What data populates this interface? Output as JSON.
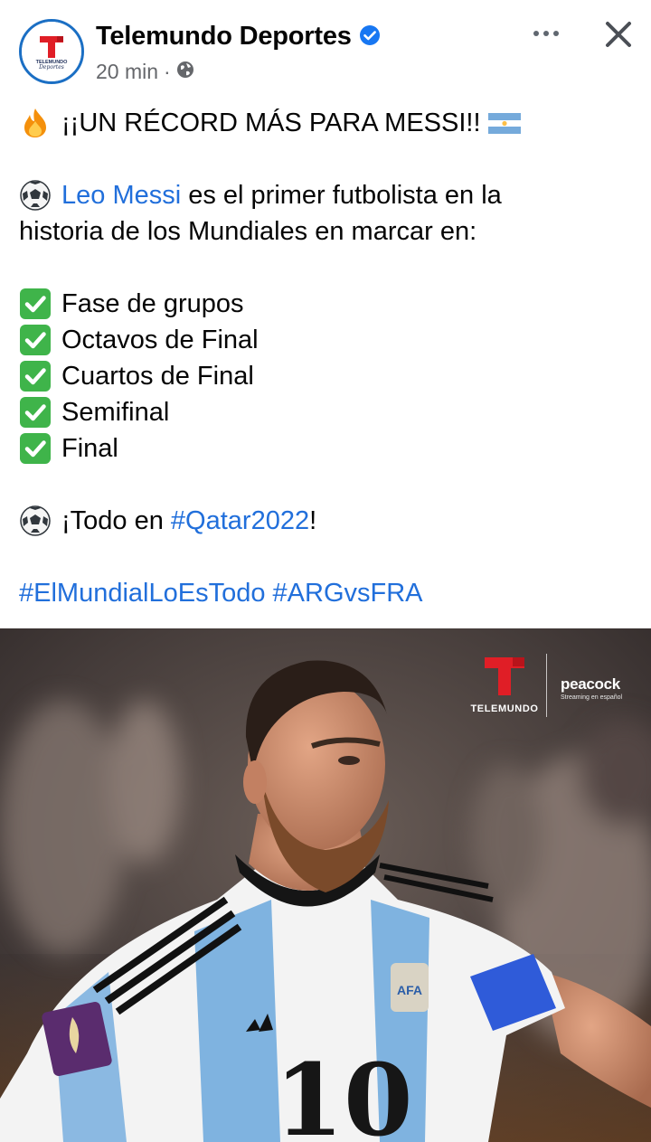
{
  "header": {
    "page_name": "Telemundo Deportes",
    "time": "20 min",
    "separator": "·",
    "avatar_text": "TELEMUNDO Deportes"
  },
  "post": {
    "line1": "¡¡UN RÉCORD MÁS PARA MESSI!!",
    "line2_link": "Leo Messi",
    "line2_rest": " es el primer futbolista en la",
    "line3": "historia de los Mundiales en marcar en:",
    "checks": [
      "Fase de grupos",
      "Octavos de Final",
      "Cuartos de Final",
      "Semifinal",
      "Final"
    ],
    "todo_prefix": "¡Todo en ",
    "todo_hashtag": "#Qatar2022",
    "todo_suffix": "!",
    "hashtag1": "#ElMundialLoEsTodo",
    "hashtag2": "#ARGvsFRA"
  },
  "image": {
    "brand": "TELEMUNDO",
    "partner": "peacock",
    "partner_sub": "Streaming en español",
    "jersey_number": "10"
  },
  "icons": {
    "verified": "verified-badge-icon",
    "globe": "globe-icon",
    "more": "more-options-icon",
    "close": "close-icon",
    "fire": "fire-emoji",
    "flag": "argentina-flag-emoji",
    "ball": "soccer-ball-emoji",
    "check": "check-mark-emoji"
  },
  "colors": {
    "link": "#216fdb",
    "meta": "#65676b",
    "verified": "#1877f2",
    "check": "#3fb44a",
    "telemundo_red": "#e01e26"
  }
}
